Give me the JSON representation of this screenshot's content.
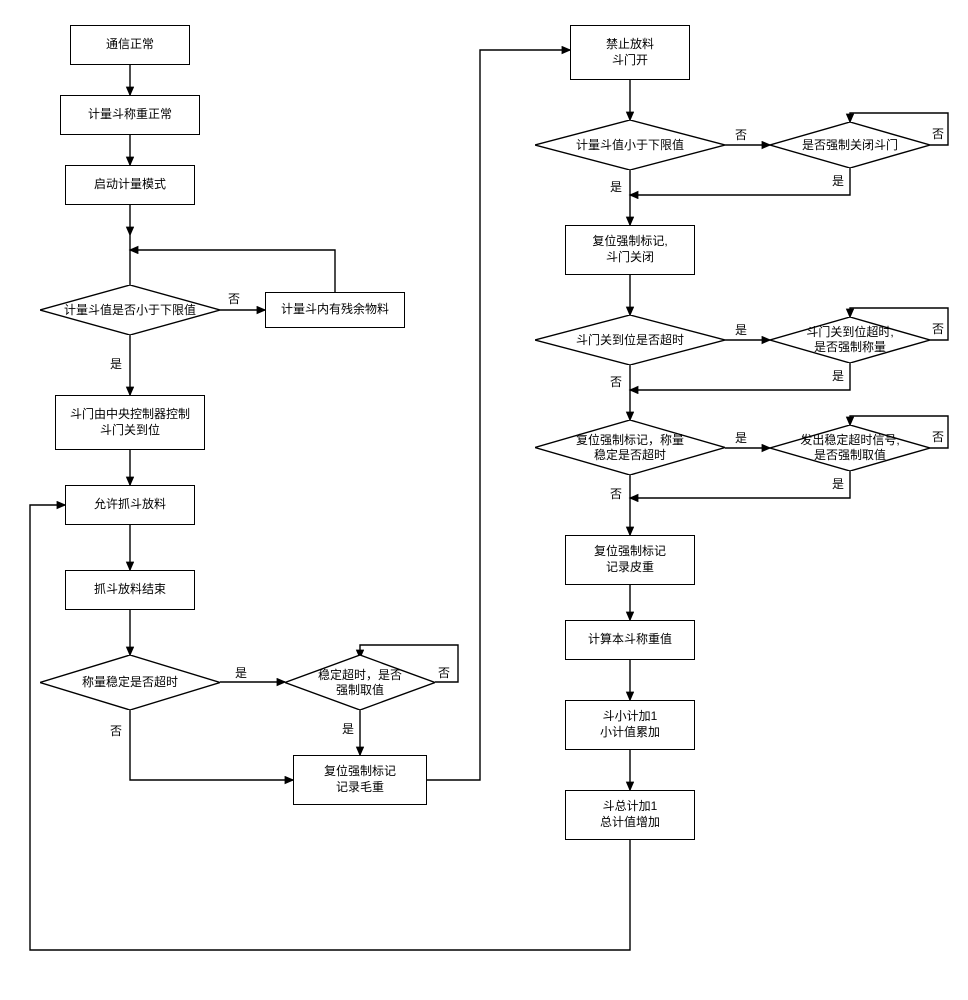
{
  "left": {
    "n1": "通信正常",
    "n2": "计量斗称重正常",
    "n3": "启动计量模式",
    "d1": "计量斗值是否小于下限值",
    "n4": "计量斗内有残余物料",
    "n5": "斗门由中央控制器控制\n斗门关到位",
    "n6": "允许抓斗放料",
    "n7": "抓斗放料结束",
    "d2": "称量稳定是否超时",
    "d3": "稳定超时，是否\n强制取值",
    "n8": "复位强制标记\n记录毛重"
  },
  "right": {
    "n1": "禁止放料\n斗门开",
    "d1": "计量斗值小于下限值",
    "d2": "是否强制关闭斗门",
    "n2": "复位强制标记,\n斗门关闭",
    "d3": "斗门关到位是否超时",
    "d4": "斗门关到位超时,\n是否强制称量",
    "d5": "复位强制标记，称量\n稳定是否超时",
    "d6": "发出稳定超时信号,\n是否强制取值",
    "n3": "复位强制标记\n记录皮重",
    "n4": "计算本斗称重值",
    "n5": "斗小计加1\n小计值累加",
    "n6": "斗总计加1\n总计值增加"
  },
  "labels": {
    "yes": "是",
    "no": "否"
  }
}
